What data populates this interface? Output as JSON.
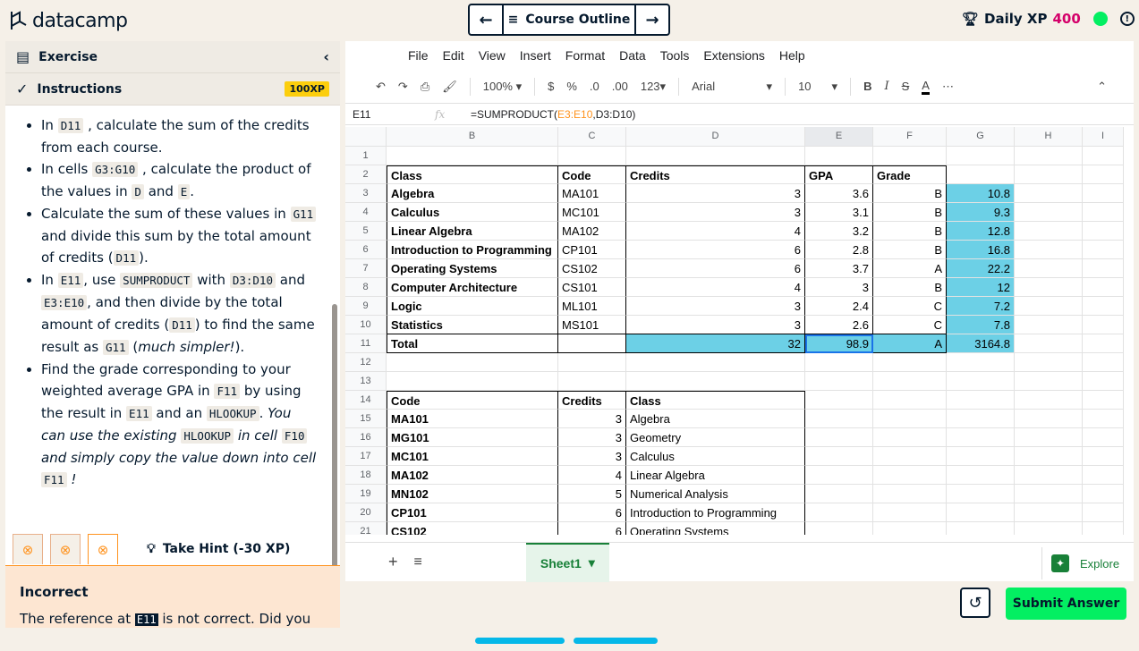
{
  "app": {
    "logo_text": "datacamp",
    "nav_title": "Course Outline",
    "xp_label": "Daily XP",
    "xp_value": "400"
  },
  "panel": {
    "exercise_label": "Exercise",
    "instructions_label": "Instructions",
    "xp_badge": "100XP",
    "hint_label": "Take Hint (-30 XP)",
    "feedback_title": "Incorrect",
    "feedback_text_1": "The reference at",
    "feedback_ref": "E11",
    "feedback_text_2": "is not correct. Did you"
  },
  "instructions": {
    "i1": {
      "a": "In",
      "c1": "D11",
      "b": ", calculate the sum of the credits from each course."
    },
    "i2": {
      "a": "In cells",
      "c1": "G3:G10",
      "b": ", calculate the product of the values in",
      "c2": "D",
      "d": "and",
      "c3": "E",
      "e": "."
    },
    "i3": {
      "a": "Calculate the sum of these values in",
      "c1": "G11",
      "b": "and divide this sum by the total amount of credits (",
      "c2": "D11",
      "c": ")."
    },
    "i4": {
      "a": "In",
      "c1": "E11",
      "b": ", use",
      "c2": "SUMPRODUCT",
      "c": "with",
      "c3": "D3:D10",
      "d": "and",
      "c4": "E3:E10",
      "e": ", and then divide by the total amount of credits (",
      "c5": "D11",
      "f": ") to find the same result as",
      "c6": "G11",
      "g": "(",
      "em": "much simpler!",
      "h": ")."
    },
    "i5": {
      "a": "Find the grade corresponding to your weighted average GPA in",
      "c1": "F11",
      "b": "by using the result in",
      "c2": "E11",
      "c": "and an",
      "c3": "HLOOKUP",
      "d": ".",
      "em1": "You can use the existing",
      "c4": "HLOOKUP",
      "em2": "in cell",
      "c5": "F10",
      "em3": "and simply copy the value down into cell",
      "c6": "F11",
      "em4": "!"
    }
  },
  "sheet": {
    "menu": [
      "File",
      "Edit",
      "View",
      "Insert",
      "Format",
      "Data",
      "Tools",
      "Extensions",
      "Help"
    ],
    "toolbar": {
      "zoom": "100%",
      "currency": "$",
      "percent": "%",
      "dec_less": ".0",
      "dec_more": ".00",
      "fmt": "123",
      "font": "Arial",
      "size": "10"
    },
    "cell_ref": "E11",
    "formula_prefix": "=SUMPRODUCT(",
    "formula_arg1": "E3:E10",
    "formula_sep": ",",
    "formula_arg2": "D3:D10",
    "formula_suffix": ")",
    "columns": [
      "B",
      "C",
      "D",
      "E",
      "F",
      "G",
      "H",
      "I"
    ],
    "rows": [
      {
        "n": "1",
        "cells": [
          "",
          "",
          "",
          "",
          "",
          ""
        ]
      },
      {
        "n": "2",
        "cells": [
          "Class",
          "Code",
          "Credits",
          "GPA",
          "Grade",
          ""
        ]
      },
      {
        "n": "3",
        "cells": [
          "Algebra",
          "MA101",
          "3",
          "3.6",
          "B",
          "10.8"
        ]
      },
      {
        "n": "4",
        "cells": [
          "Calculus",
          "MC101",
          "3",
          "3.1",
          "B",
          "9.3"
        ]
      },
      {
        "n": "5",
        "cells": [
          "Linear Algebra",
          "MA102",
          "4",
          "3.2",
          "B",
          "12.8"
        ]
      },
      {
        "n": "6",
        "cells": [
          "Introduction to Programming",
          "CP101",
          "6",
          "2.8",
          "B",
          "16.8"
        ]
      },
      {
        "n": "7",
        "cells": [
          "Operating Systems",
          "CS102",
          "6",
          "3.7",
          "A",
          "22.2"
        ]
      },
      {
        "n": "8",
        "cells": [
          "Computer Architecture",
          "CS101",
          "4",
          "3",
          "B",
          "12"
        ]
      },
      {
        "n": "9",
        "cells": [
          "Logic",
          "ML101",
          "3",
          "2.4",
          "C",
          "7.2"
        ]
      },
      {
        "n": "10",
        "cells": [
          "Statistics",
          "MS101",
          "3",
          "2.6",
          "C",
          "7.8"
        ]
      },
      {
        "n": "11",
        "cells": [
          "Total",
          "",
          "32",
          "98.9",
          "A",
          "3164.8"
        ]
      },
      {
        "n": "12",
        "cells": [
          "",
          "",
          "",
          "",
          "",
          ""
        ]
      },
      {
        "n": "13",
        "cells": [
          "",
          "",
          "",
          "",
          "",
          ""
        ]
      },
      {
        "n": "14",
        "cells": [
          "Code",
          "Credits",
          "Class",
          "",
          "",
          ""
        ]
      },
      {
        "n": "15",
        "cells": [
          "MA101",
          "3",
          "Algebra",
          "",
          "",
          ""
        ]
      },
      {
        "n": "16",
        "cells": [
          "MG101",
          "3",
          "Geometry",
          "",
          "",
          ""
        ]
      },
      {
        "n": "17",
        "cells": [
          "MC101",
          "3",
          "Calculus",
          "",
          "",
          ""
        ]
      },
      {
        "n": "18",
        "cells": [
          "MA102",
          "4",
          "Linear Algebra",
          "",
          "",
          ""
        ]
      },
      {
        "n": "19",
        "cells": [
          "MN102",
          "5",
          "Numerical Analysis",
          "",
          "",
          ""
        ]
      },
      {
        "n": "20",
        "cells": [
          "CP101",
          "6",
          "Introduction to Programming",
          "",
          "",
          ""
        ]
      },
      {
        "n": "21",
        "cells": [
          "CS102",
          "6",
          "Operating Systems",
          "",
          "",
          ""
        ]
      }
    ],
    "tab_name": "Sheet1",
    "explore_label": "Explore"
  },
  "submit_label": "Submit Answer",
  "colors": {
    "accent_green": "#03ef62",
    "xp_pink": "#d4006a",
    "highlight_blue": "#6cd0e6",
    "warn_orange": "#ff931e"
  }
}
